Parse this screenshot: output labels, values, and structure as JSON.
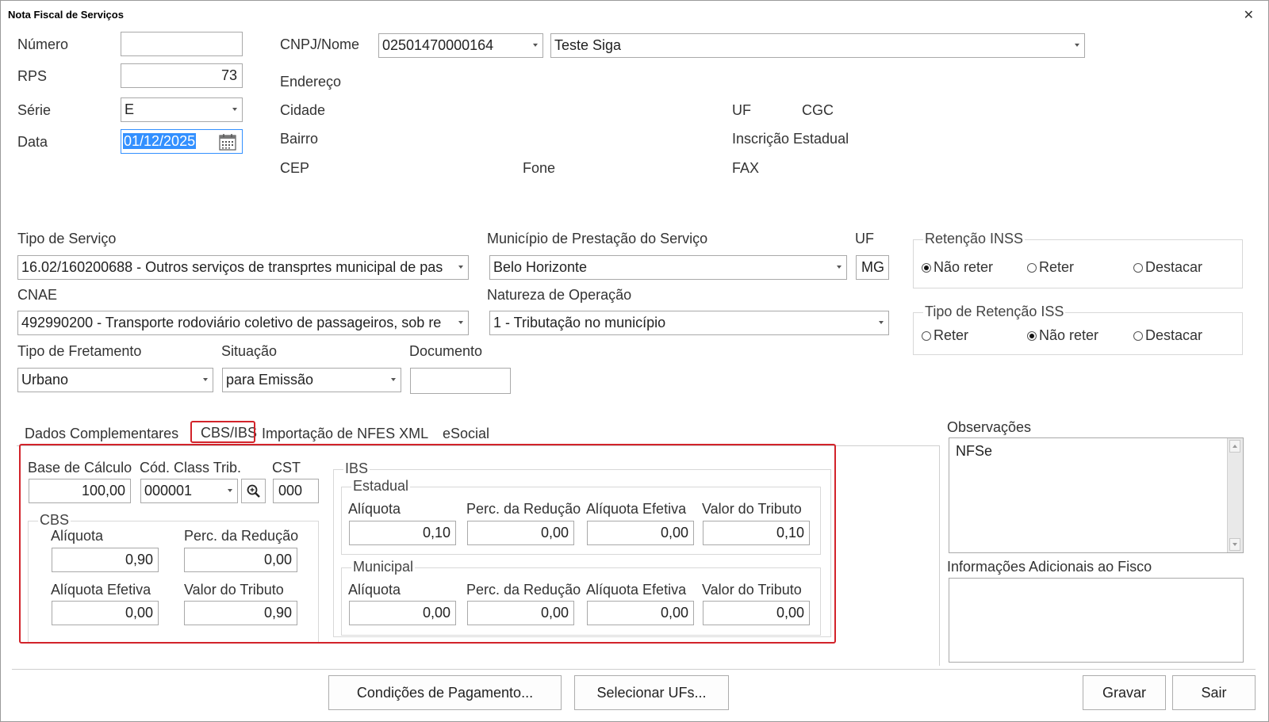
{
  "window": {
    "title": "Nota Fiscal de Serviços",
    "close_glyph": "✕"
  },
  "header": {
    "numero_label": "Número",
    "numero_value": "",
    "rps_label": "RPS",
    "rps_value": "73",
    "serie_label": "Série",
    "serie_value": "E",
    "data_label": "Data",
    "data_value": "01/12/2025"
  },
  "cliente": {
    "cnpj_label": "CNPJ/Nome",
    "cnpj_value": "02501470000164",
    "nome_value": "Teste Siga",
    "endereco_label": "Endereço",
    "cidade_label": "Cidade",
    "bairro_label": "Bairro",
    "cep_label": "CEP",
    "fone_label": "Fone",
    "uf_label": "UF",
    "cgc_label": "CGC",
    "inscricao_label": "Inscrição Estadual",
    "fax_label": "FAX"
  },
  "servico": {
    "tipo_label": "Tipo de Serviço",
    "tipo_value": "16.02/160200688 - Outros serviços de transprtes municipal de pas",
    "municipio_label": "Município de Prestação do Serviço",
    "municipio_value": "Belo Horizonte",
    "uf_label": "UF",
    "uf_value": "MG",
    "cnae_label": "CNAE",
    "cnae_value": "492990200 - Transporte rodoviário coletivo de passageiros, sob re",
    "natureza_label": "Natureza de Operação",
    "natureza_value": "1 - Tributação no município",
    "fretamento_label": "Tipo de Fretamento",
    "fretamento_value": "Urbano",
    "situacao_label": "Situação",
    "situacao_value": "para Emissão",
    "documento_label": "Documento",
    "documento_value": ""
  },
  "retencao_inss": {
    "label": "Retenção INSS",
    "options": [
      "Não reter",
      "Reter",
      "Destacar"
    ],
    "selected": "Não reter"
  },
  "retencao_iss": {
    "label": "Tipo de Retenção ISS",
    "options": [
      "Reter",
      "Não reter",
      "Destacar"
    ],
    "selected": "Não reter"
  },
  "tabs": [
    {
      "label": "Dados Complementares",
      "active": false
    },
    {
      "label": "CBS/IBS",
      "active": true
    },
    {
      "label": "Importação de NFES XML",
      "active": false
    },
    {
      "label": "eSocial",
      "active": false
    }
  ],
  "cbsibs": {
    "base_label": "Base de Cálculo",
    "base_value": "100,00",
    "cod_label": "Cód. Class Trib.",
    "cod_value": "000001",
    "cst_label": "CST",
    "cst_value": "000",
    "cbs": {
      "title": "CBS",
      "aliquota_label": "Alíquota",
      "aliquota_value": "0,90",
      "reducao_label": "Perc. da Redução",
      "reducao_value": "0,00",
      "efetiva_label": "Alíquota Efetiva",
      "efetiva_value": "0,00",
      "tributo_label": "Valor do Tributo",
      "tributo_value": "0,90"
    },
    "ibs": {
      "title": "IBS",
      "estadual": {
        "title": "Estadual",
        "aliquota_label": "Alíquota",
        "aliquota_value": "0,10",
        "reducao_label": "Perc. da Redução",
        "reducao_value": "0,00",
        "efetiva_label": "Alíquota Efetiva",
        "efetiva_value": "0,00",
        "tributo_label": "Valor do Tributo",
        "tributo_value": "0,10"
      },
      "municipal": {
        "title": "Municipal",
        "aliquota_label": "Alíquota",
        "aliquota_value": "0,00",
        "reducao_label": "Perc. da Redução",
        "reducao_value": "0,00",
        "efetiva_label": "Alíquota Efetiva",
        "efetiva_value": "0,00",
        "tributo_label": "Valor do Tributo",
        "tributo_value": "0,00"
      }
    }
  },
  "observacoes": {
    "label": "Observações",
    "value": "NFSe"
  },
  "info_fisco": {
    "label": "Informações Adicionais ao Fisco",
    "value": ""
  },
  "buttons": {
    "condicoes": "Condições de Pagamento...",
    "selecionar_ufs": "Selecionar UFs...",
    "gravar": "Gravar",
    "sair": "Sair"
  },
  "colors": {
    "highlight": "#d2232a",
    "selection": "#3390ff"
  }
}
